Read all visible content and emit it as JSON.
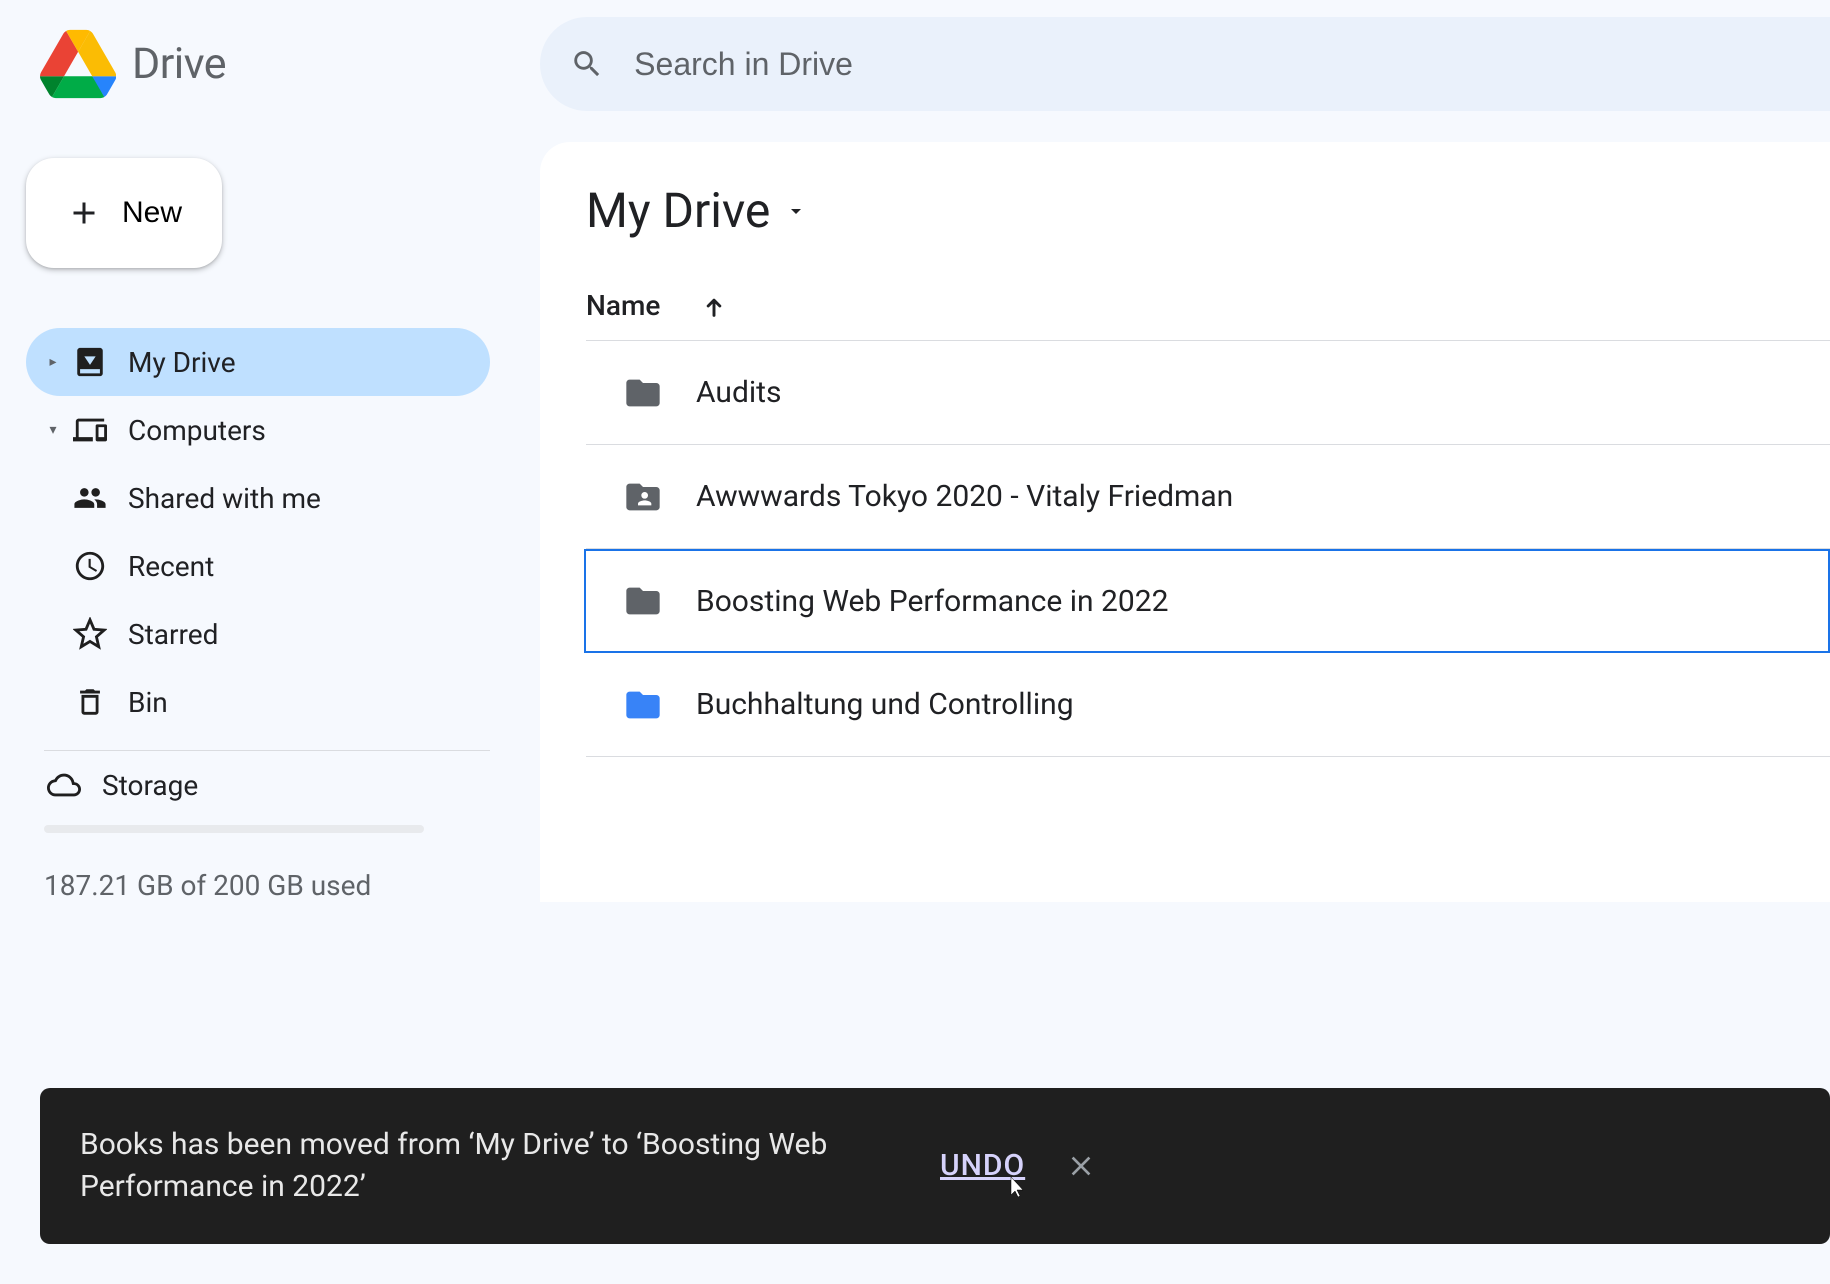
{
  "app": {
    "name": "Drive"
  },
  "search": {
    "placeholder": "Search in Drive"
  },
  "newButton": {
    "label": "New"
  },
  "sidebar": {
    "items": [
      {
        "label": "My Drive"
      },
      {
        "label": "Computers"
      },
      {
        "label": "Shared with me"
      },
      {
        "label": "Recent"
      },
      {
        "label": "Starred"
      },
      {
        "label": "Bin"
      }
    ],
    "storage": {
      "label": "Storage",
      "text": "187.21 GB of 200 GB used"
    }
  },
  "breadcrumb": {
    "title": "My Drive"
  },
  "table": {
    "nameHeader": "Name"
  },
  "files": [
    {
      "name": "Audits",
      "icon": "folder",
      "color": "#5f6368"
    },
    {
      "name": "Awwwards Tokyo 2020 - Vitaly Friedman",
      "icon": "shared-folder",
      "color": "#5f6368"
    },
    {
      "name": "Boosting Web Performance in 2022",
      "icon": "folder",
      "color": "#5f6368",
      "selected": true
    },
    {
      "name": "Buchhaltung und Controlling",
      "icon": "folder",
      "color": "#3883f7"
    }
  ],
  "toast": {
    "message": "Books has been moved from ‘My Drive’ to ‘Boosting Web Performance in 2022’",
    "undo": "UNDO"
  }
}
